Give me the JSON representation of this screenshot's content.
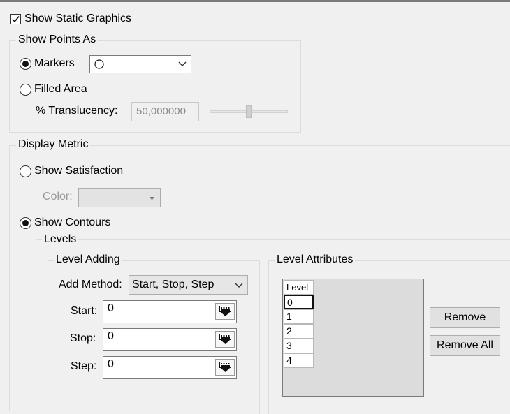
{
  "static_graphics": {
    "label": "Show Static Graphics",
    "checked": true
  },
  "points_group": {
    "legend": "Show Points As",
    "markers_label": "Markers",
    "markers_selected": true,
    "marker_symbol": "circle-icon",
    "filled_area_label": "Filled Area",
    "translucency_label": "% Translucency:",
    "translucency_value": "50,000000",
    "translucency_slider": 50
  },
  "metric_group": {
    "legend": "Display Metric",
    "satisfaction_label": "Show Satisfaction",
    "color_label": "Color:",
    "contours_label": "Show Contours",
    "contours_selected": true
  },
  "levels": {
    "legend": "Levels",
    "adding": {
      "legend": "Level Adding",
      "method_label": "Add Method:",
      "method_value": "Start, Stop, Step",
      "start_label": "Start:",
      "start_value": "0",
      "stop_label": "Stop:",
      "stop_value": "0",
      "step_label": "Step:",
      "step_value": "0"
    },
    "attributes": {
      "legend": "Level Attributes",
      "column_header": "Level",
      "rows": [
        "0",
        "1",
        "2",
        "3",
        "4"
      ],
      "remove_label": "Remove",
      "remove_all_label": "Remove All"
    }
  }
}
